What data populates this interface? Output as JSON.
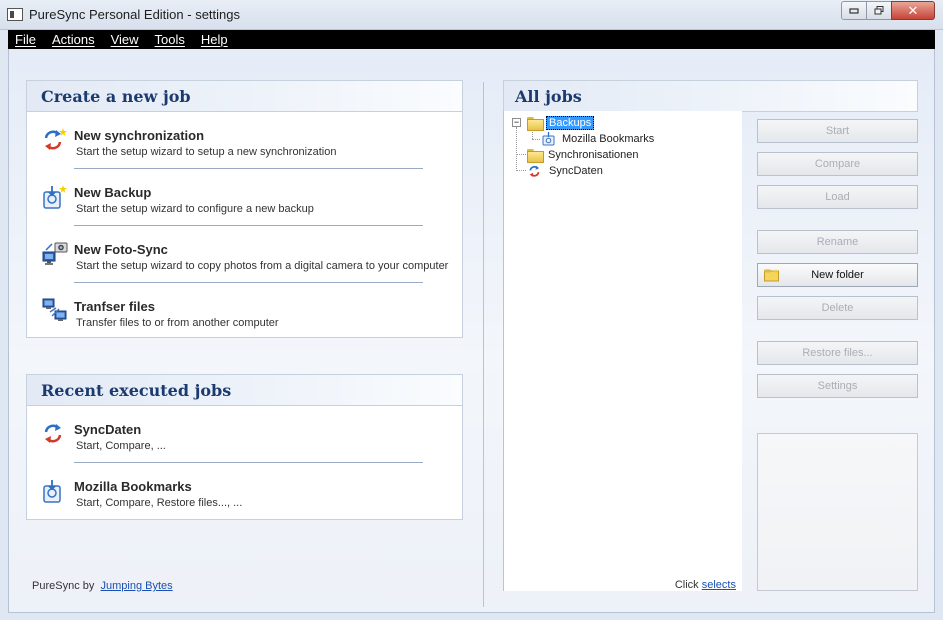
{
  "window": {
    "title": "PureSync Personal Edition  -  settings",
    "controls": {
      "minimize": "▭",
      "maximize": "◻",
      "close": "✕"
    }
  },
  "menu": [
    "File",
    "Actions",
    "View",
    "Tools",
    "Help"
  ],
  "create_panel": {
    "title": "Create a new job",
    "tasks": [
      {
        "title": "New synchronization",
        "subtitle": "Start the setup wizard to setup a new synchronization",
        "icon": "sync-new-icon"
      },
      {
        "title": "New Backup",
        "subtitle": "Start the setup wizard to configure a new backup",
        "icon": "backup-new-icon"
      },
      {
        "title": "New Foto-Sync",
        "subtitle": "Start the setup wizard to copy photos from a digital camera to your computer",
        "icon": "camera-icon"
      },
      {
        "title": "Tranfser files",
        "subtitle": "Transfer files to or from another computer",
        "icon": "computers-icon"
      }
    ]
  },
  "recent_panel": {
    "title": "Recent executed jobs",
    "jobs": [
      {
        "title": "SyncDaten",
        "subtitle": "Start, Compare, ...",
        "icon": "sync-icon"
      },
      {
        "title": "Mozilla Bookmarks",
        "subtitle": "Start, Compare, Restore files..., ...",
        "icon": "backup-icon"
      }
    ]
  },
  "footer": {
    "prefix": "PureSync by",
    "link": "Jumping Bytes"
  },
  "all_jobs": {
    "title": "All jobs",
    "tree": {
      "backups": "Backups",
      "mozilla": "Mozilla Bookmarks",
      "synchronisationen": "Synchronisationen",
      "syncdaten": "SyncDaten"
    },
    "hint_prefix": "Click",
    "hint_link": "selects"
  },
  "buttons": {
    "start": "Start",
    "compare": "Compare",
    "load": "Load",
    "rename": "Rename",
    "new_folder": "New folder",
    "delete": "Delete",
    "restore": "Restore files...",
    "settings": "Settings"
  },
  "colors": {
    "header_text": "#1b3a6e",
    "selection": "#3399ff",
    "link": "#1a4fb3",
    "menubar": "#000000"
  }
}
